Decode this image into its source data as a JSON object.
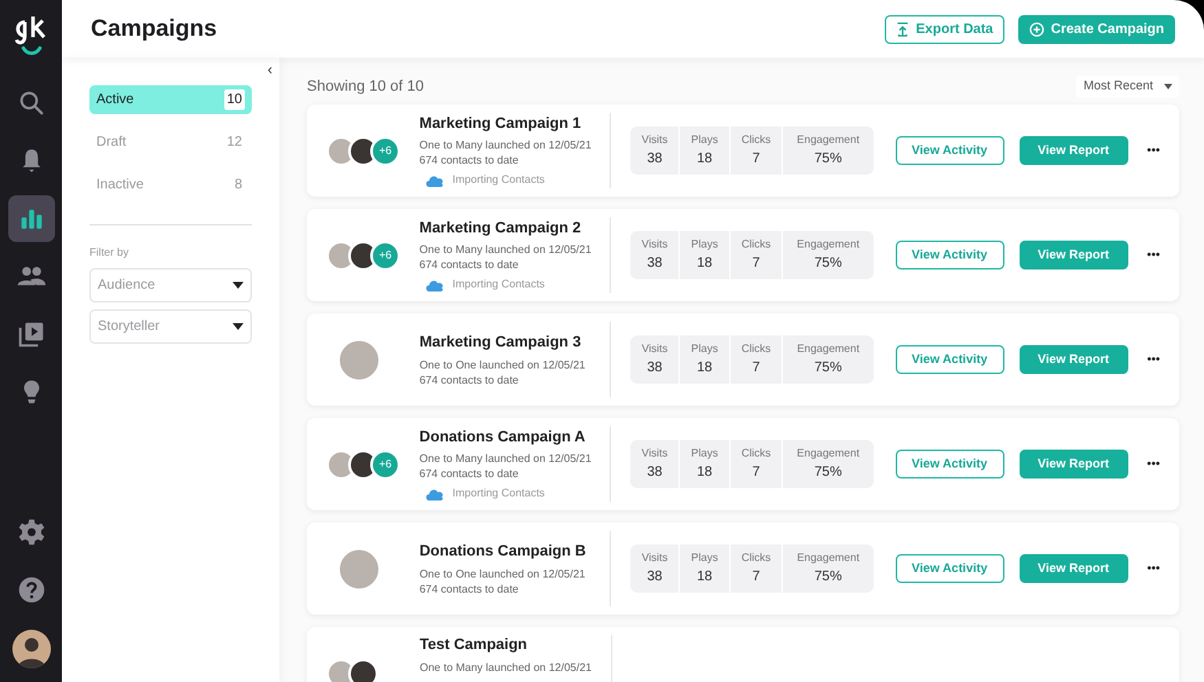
{
  "header": {
    "title": "Campaigns",
    "buttons": [
      {
        "label": "Export Data",
        "kind": "outline"
      },
      {
        "label": "Create Campaign",
        "kind": "solid"
      }
    ]
  },
  "nav": [
    {
      "selected": false
    },
    {
      "selected": false
    },
    {
      "selected": true
    },
    {
      "selected": false
    },
    {
      "selected": false
    },
    {
      "selected": false
    },
    {
      "selected": false
    },
    {
      "selected": false
    }
  ],
  "collapse": "‹",
  "statuses": [
    {
      "label": "Active",
      "count": "10",
      "selected": true
    },
    {
      "label": "Draft",
      "count": "12",
      "selected": false
    },
    {
      "label": "Inactive",
      "count": "8",
      "selected": false
    }
  ],
  "filter": {
    "label": "Filter by",
    "dropdowns": [
      "Audience",
      "Storyteller"
    ]
  },
  "summary": "Showing 10 of 10",
  "sort": "Most Recent",
  "campaigns": [
    {
      "title": "Marketing Campaign 1",
      "line1": "One to Many launched on 12/05/21",
      "line2": "674 contacts to date",
      "kind": "group",
      "extra": "+6",
      "importing": "Importing Contacts",
      "stats": [
        {
          "label": "Visits",
          "value": "38"
        },
        {
          "label": "Plays",
          "value": "18"
        },
        {
          "label": "Clicks",
          "value": "7"
        },
        {
          "label": "Engagement",
          "value": "75%"
        }
      ],
      "actions": [
        "View Activity",
        "View Report"
      ],
      "more": "•••"
    },
    {
      "title": "Marketing Campaign 2",
      "line1": "One to Many launched on 12/05/21",
      "line2": "674 contacts to date",
      "kind": "group",
      "extra": "+6",
      "importing": "Importing Contacts",
      "stats": [
        {
          "label": "Visits",
          "value": "38"
        },
        {
          "label": "Plays",
          "value": "18"
        },
        {
          "label": "Clicks",
          "value": "7"
        },
        {
          "label": "Engagement",
          "value": "75%"
        }
      ],
      "actions": [
        "View Activity",
        "View Report"
      ],
      "more": "•••"
    },
    {
      "title": "Marketing Campaign 3",
      "line1": "One to One launched on 12/05/21",
      "line2": "674 contacts to date",
      "kind": "single",
      "stats": [
        {
          "label": "Visits",
          "value": "38"
        },
        {
          "label": "Plays",
          "value": "18"
        },
        {
          "label": "Clicks",
          "value": "7"
        },
        {
          "label": "Engagement",
          "value": "75%"
        }
      ],
      "actions": [
        "View Activity",
        "View Report"
      ],
      "more": "•••"
    },
    {
      "title": "Donations Campaign A",
      "line1": "One to Many launched on 12/05/21",
      "line2": "674 contacts to date",
      "kind": "group",
      "extra": "+6",
      "importing": "Importing Contacts",
      "stats": [
        {
          "label": "Visits",
          "value": "38"
        },
        {
          "label": "Plays",
          "value": "18"
        },
        {
          "label": "Clicks",
          "value": "7"
        },
        {
          "label": "Engagement",
          "value": "75%"
        }
      ],
      "actions": [
        "View Activity",
        "View Report"
      ],
      "more": "•••"
    },
    {
      "title": "Donations Campaign B",
      "line1": "One to One launched on 12/05/21",
      "line2": "674 contacts to date",
      "kind": "single",
      "stats": [
        {
          "label": "Visits",
          "value": "38"
        },
        {
          "label": "Plays",
          "value": "18"
        },
        {
          "label": "Clicks",
          "value": "7"
        },
        {
          "label": "Engagement",
          "value": "75%"
        }
      ],
      "actions": [
        "View Activity",
        "View Report"
      ],
      "more": "•••"
    },
    {
      "title": "Test Campaign",
      "line1": "One to Many launched on 12/05/21",
      "kind": "group"
    }
  ]
}
